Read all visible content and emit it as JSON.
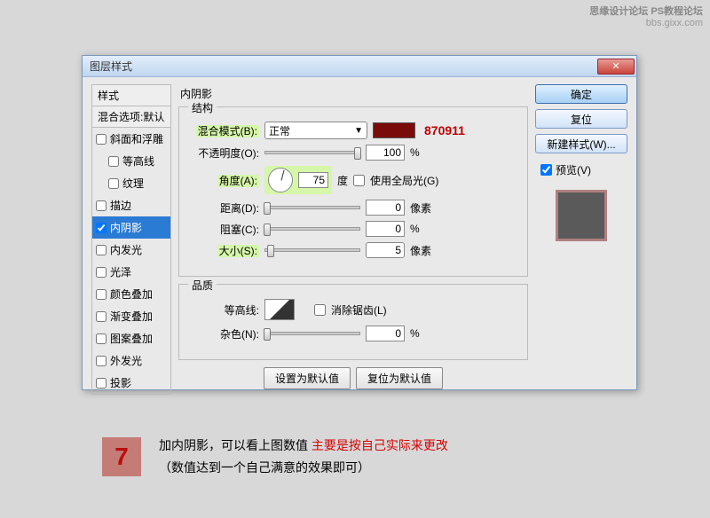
{
  "watermark": {
    "line1": "思缘设计论坛  PS教程论坛",
    "line2": "bbs.gixx.com"
  },
  "dialog": {
    "title": "图层样式",
    "close": "✕",
    "left": {
      "header": "样式",
      "sub": "混合选项:默认",
      "items": [
        {
          "label": "斜面和浮雕",
          "checked": false,
          "selected": false
        },
        {
          "label": "等高线",
          "checked": false,
          "selected": false,
          "indent": true
        },
        {
          "label": "纹理",
          "checked": false,
          "selected": false,
          "indent": true
        },
        {
          "label": "描边",
          "checked": false,
          "selected": false
        },
        {
          "label": "内阴影",
          "checked": true,
          "selected": true
        },
        {
          "label": "内发光",
          "checked": false,
          "selected": false
        },
        {
          "label": "光泽",
          "checked": false,
          "selected": false
        },
        {
          "label": "颜色叠加",
          "checked": false,
          "selected": false
        },
        {
          "label": "渐变叠加",
          "checked": false,
          "selected": false
        },
        {
          "label": "图案叠加",
          "checked": false,
          "selected": false
        },
        {
          "label": "外发光",
          "checked": false,
          "selected": false
        },
        {
          "label": "投影",
          "checked": false,
          "selected": false
        }
      ]
    },
    "middle": {
      "panel_title": "内阴影",
      "structure_legend": "结构",
      "blend_mode_label": "混合模式(B):",
      "blend_mode_value": "正常",
      "annotation": "870911",
      "opacity_label": "不透明度(O):",
      "opacity_value": "100",
      "opacity_unit": "%",
      "angle_label": "角度(A):",
      "angle_value": "75",
      "angle_unit": "度",
      "global_light_label": "使用全局光(G)",
      "distance_label": "距离(D):",
      "distance_value": "0",
      "distance_unit": "像素",
      "choke_label": "阻塞(C):",
      "choke_value": "0",
      "choke_unit": "%",
      "size_label": "大小(S):",
      "size_value": "5",
      "size_unit": "像素",
      "quality_legend": "品质",
      "contour_label": "等高线:",
      "antialias_label": "消除锯齿(L)",
      "noise_label": "杂色(N):",
      "noise_value": "0",
      "noise_unit": "%",
      "reset_default": "设置为默认值",
      "restore_default": "复位为默认值"
    },
    "right": {
      "ok": "确定",
      "reset": "复位",
      "new_style": "新建样式(W)...",
      "preview_label": "预览(V)"
    }
  },
  "caption": {
    "step": "7",
    "line1a": "加内阴影，可以看上图数值    ",
    "line1b": "主要是按自己实际来更改",
    "line2": "（数值达到一个自己满意的效果即可）"
  }
}
